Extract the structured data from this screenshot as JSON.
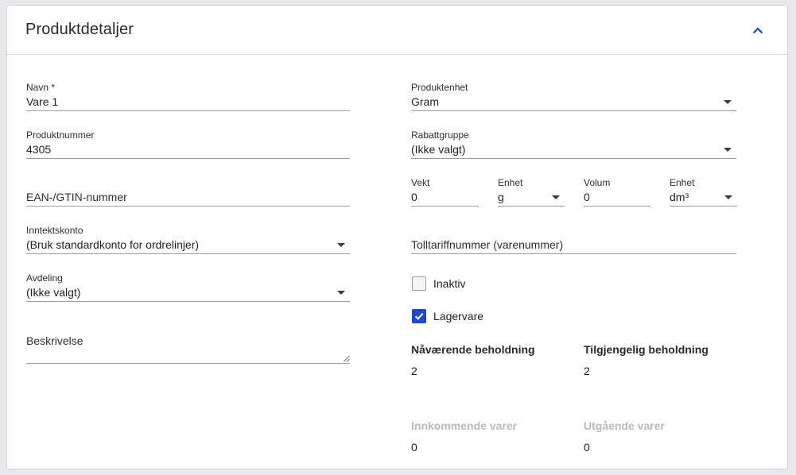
{
  "header": {
    "title": "Produktdetaljer",
    "collapse_icon": "chevron-up-icon",
    "accent_color": "#1f47d6"
  },
  "left": {
    "name": {
      "label": "Navn *",
      "value": "Vare 1"
    },
    "product_number": {
      "label": "Produktnummer",
      "value": "4305"
    },
    "ean": {
      "placeholder": "EAN-/GTIN-nummer"
    },
    "income_account": {
      "label": "Inntektskonto",
      "value": "(Bruk standardkonto for ordrelinjer)"
    },
    "department": {
      "label": "Avdeling",
      "value": "(Ikke valgt)"
    },
    "description": {
      "placeholder": "Beskrivelse"
    }
  },
  "right": {
    "product_unit": {
      "label": "Produktenhet",
      "value": "Gram"
    },
    "discount_group": {
      "label": "Rabattgruppe",
      "value": "(Ikke valgt)"
    },
    "weight": {
      "label": "Vekt",
      "value": "0"
    },
    "weight_unit": {
      "label": "Enhet",
      "value": "g"
    },
    "volume": {
      "label": "Volum",
      "value": "0"
    },
    "volume_unit": {
      "label": "Enhet",
      "value": "dm³"
    },
    "customs_tariff": {
      "placeholder": "Tolltariffnummer (varenummer)"
    },
    "inactive": {
      "label": "Inaktiv",
      "checked": false
    },
    "stock_item": {
      "label": "Lagervare",
      "checked": true
    },
    "current_stock": {
      "label": "Nåværende beholdning",
      "value": "2"
    },
    "available_stock": {
      "label": "Tilgjengelig beholdning",
      "value": "2"
    },
    "incoming": {
      "label": "Innkommende varer",
      "value": "0"
    },
    "outgoing": {
      "label": "Utgående varer",
      "value": "0"
    }
  }
}
